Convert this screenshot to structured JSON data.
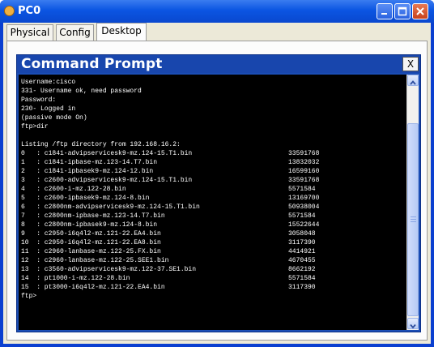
{
  "window": {
    "title": "PC0",
    "controls": [
      "minimize-icon",
      "maximize-icon",
      "close-icon"
    ]
  },
  "tabs": [
    {
      "label": "Physical",
      "active": false
    },
    {
      "label": "Config",
      "active": false
    },
    {
      "label": "Desktop",
      "active": true
    }
  ],
  "command_prompt": {
    "title": "Command Prompt",
    "close_label": "X",
    "header_lines": [
      "Username:cisco",
      "331- Username ok, need password",
      "Password:",
      "230- Logged in",
      "(passive mode On)",
      "ftp>dir",
      "",
      "Listing /ftp directory from 192.168.16.2:"
    ],
    "listing": [
      {
        "name": "0   : c1841-advipservicesk9-mz.124-15.T1.bin",
        "size": "33591768"
      },
      {
        "name": "1   : c1841-ipbase-mz.123-14.T7.bin",
        "size": "13832032"
      },
      {
        "name": "2   : c1841-ipbasek9-mz.124-12.bin",
        "size": "16599160"
      },
      {
        "name": "3   : c2600-advipservicesk9-mz.124-15.T1.bin",
        "size": "33591768"
      },
      {
        "name": "4   : c2600-i-mz.122-28.bin",
        "size": "5571584"
      },
      {
        "name": "5   : c2600-ipbasek9-mz.124-8.bin",
        "size": "13169700"
      },
      {
        "name": "6   : c2800nm-advipservicesk9-mz.124-15.T1.bin",
        "size": "50938004"
      },
      {
        "name": "7   : c2800nm-ipbase-mz.123-14.T7.bin",
        "size": "5571584"
      },
      {
        "name": "8   : c2800nm-ipbasek9-mz.124-8.bin",
        "size": "15522644"
      },
      {
        "name": "9   : c2950-i6q4l2-mz.121-22.EA4.bin",
        "size": "3058048"
      },
      {
        "name": "10  : c2950-i6q4l2-mz.121-22.EA8.bin",
        "size": "3117390"
      },
      {
        "name": "11  : c2960-lanbase-mz.122-25.FX.bin",
        "size": "4414921"
      },
      {
        "name": "12  : c2960-lanbase-mz.122-25.SEE1.bin",
        "size": "4670455"
      },
      {
        "name": "13  : c3560-advipservicesk9-mz.122-37.SE1.bin",
        "size": "8662192"
      },
      {
        "name": "14  : pt1000-i-mz.122-28.bin",
        "size": "5571584"
      },
      {
        "name": "15  : pt3000-i6q4l2-mz.121-22.EA4.bin",
        "size": "3117390"
      }
    ],
    "prompt": "ftp>"
  }
}
